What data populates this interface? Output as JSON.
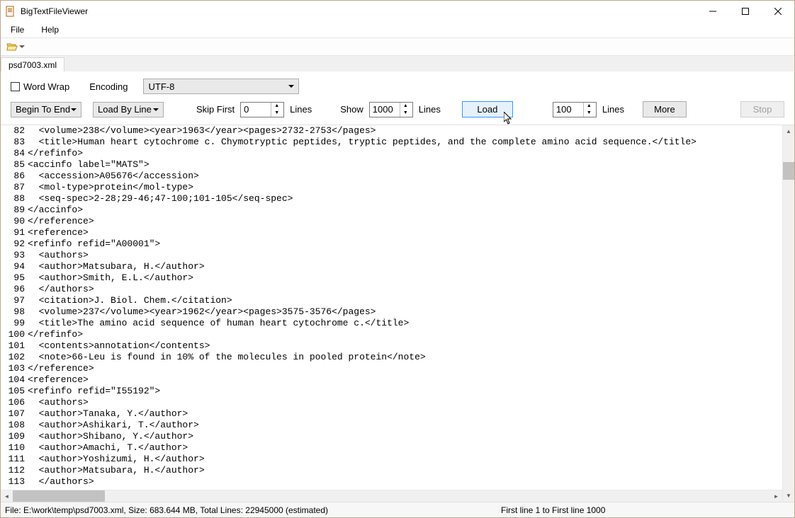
{
  "window": {
    "title": "BigTextFileViewer"
  },
  "menu": {
    "file": "File",
    "help": "Help"
  },
  "tab": {
    "name": "psd7003.xml"
  },
  "controls": {
    "wordwrap_label": "Word Wrap",
    "encoding_label": "Encoding",
    "encoding_value": "UTF-8",
    "direction": "Begin To End",
    "load_mode": "Load By Line",
    "skip_first_label": "Skip First",
    "skip_first_value": "0",
    "skip_first_unit": "Lines",
    "show_label": "Show",
    "show_value": "1000",
    "show_unit": "Lines",
    "load_btn": "Load",
    "more_value": "100",
    "more_unit": "Lines",
    "more_btn": "More",
    "stop_btn": "Stop"
  },
  "lines": [
    {
      "n": "82",
      "t": "  <volume>238</volume><year>1963</year><pages>2732-2753</pages>"
    },
    {
      "n": "83",
      "t": "  <title>Human heart cytochrome c. Chymotryptic peptides, tryptic peptides, and the complete amino acid sequence.</title>"
    },
    {
      "n": "84",
      "t": "</refinfo>"
    },
    {
      "n": "85",
      "t": "<accinfo label=\"MATS\">"
    },
    {
      "n": "86",
      "t": "  <accession>A05676</accession>"
    },
    {
      "n": "87",
      "t": "  <mol-type>protein</mol-type>"
    },
    {
      "n": "88",
      "t": "  <seq-spec>2-28;29-46;47-100;101-105</seq-spec>"
    },
    {
      "n": "89",
      "t": "</accinfo>"
    },
    {
      "n": "90",
      "t": "</reference>"
    },
    {
      "n": "91",
      "t": "<reference>"
    },
    {
      "n": "92",
      "t": "<refinfo refid=\"A00001\">"
    },
    {
      "n": "93",
      "t": "  <authors>"
    },
    {
      "n": "94",
      "t": "  <author>Matsubara, H.</author>"
    },
    {
      "n": "95",
      "t": "  <author>Smith, E.L.</author>"
    },
    {
      "n": "96",
      "t": "  </authors>"
    },
    {
      "n": "97",
      "t": "  <citation>J. Biol. Chem.</citation>"
    },
    {
      "n": "98",
      "t": "  <volume>237</volume><year>1962</year><pages>3575-3576</pages>"
    },
    {
      "n": "99",
      "t": "  <title>The amino acid sequence of human heart cytochrome c.</title>"
    },
    {
      "n": "100",
      "t": "</refinfo>"
    },
    {
      "n": "101",
      "t": "  <contents>annotation</contents>"
    },
    {
      "n": "102",
      "t": "  <note>66-Leu is found in 10% of the molecules in pooled protein</note>"
    },
    {
      "n": "103",
      "t": "</reference>"
    },
    {
      "n": "104",
      "t": "<reference>"
    },
    {
      "n": "105",
      "t": "<refinfo refid=\"I55192\">"
    },
    {
      "n": "106",
      "t": "  <authors>"
    },
    {
      "n": "107",
      "t": "  <author>Tanaka, Y.</author>"
    },
    {
      "n": "108",
      "t": "  <author>Ashikari, T.</author>"
    },
    {
      "n": "109",
      "t": "  <author>Shibano, Y.</author>"
    },
    {
      "n": "110",
      "t": "  <author>Amachi, T.</author>"
    },
    {
      "n": "111",
      "t": "  <author>Yoshizumi, H.</author>"
    },
    {
      "n": "112",
      "t": "  <author>Matsubara, H.</author>"
    },
    {
      "n": "113",
      "t": "  </authors>"
    }
  ],
  "status": {
    "left": "File: E:\\work\\temp\\psd7003.xml, Size: 683.644 MB, Total Lines: 22945000 (estimated)",
    "right": "First line 1 to First line 1000"
  }
}
